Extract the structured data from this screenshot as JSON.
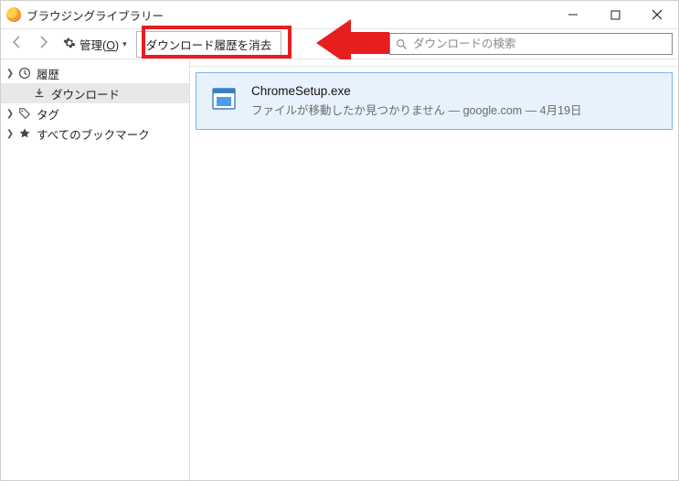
{
  "window": {
    "title": "ブラウジングライブラリー"
  },
  "toolbar": {
    "manage_label": "管理",
    "manage_accel": "O",
    "clear_label": "ダウンロード履歴を消去",
    "search_placeholder": "ダウンロードの検索"
  },
  "sidebar": {
    "items": [
      {
        "label": "履歴",
        "icon": "clock-icon",
        "expandable": true
      },
      {
        "label": "ダウンロード",
        "icon": "download-icon",
        "selected": true,
        "child": true
      },
      {
        "label": "タグ",
        "icon": "tag-icon",
        "expandable": true
      },
      {
        "label": "すべてのブックマーク",
        "icon": "star-icon",
        "expandable": true
      }
    ]
  },
  "downloads": [
    {
      "name": "ChromeSetup.exe",
      "status": "ファイルが移動したか見つかりません",
      "host": "google.com",
      "date": "4月19日"
    }
  ]
}
